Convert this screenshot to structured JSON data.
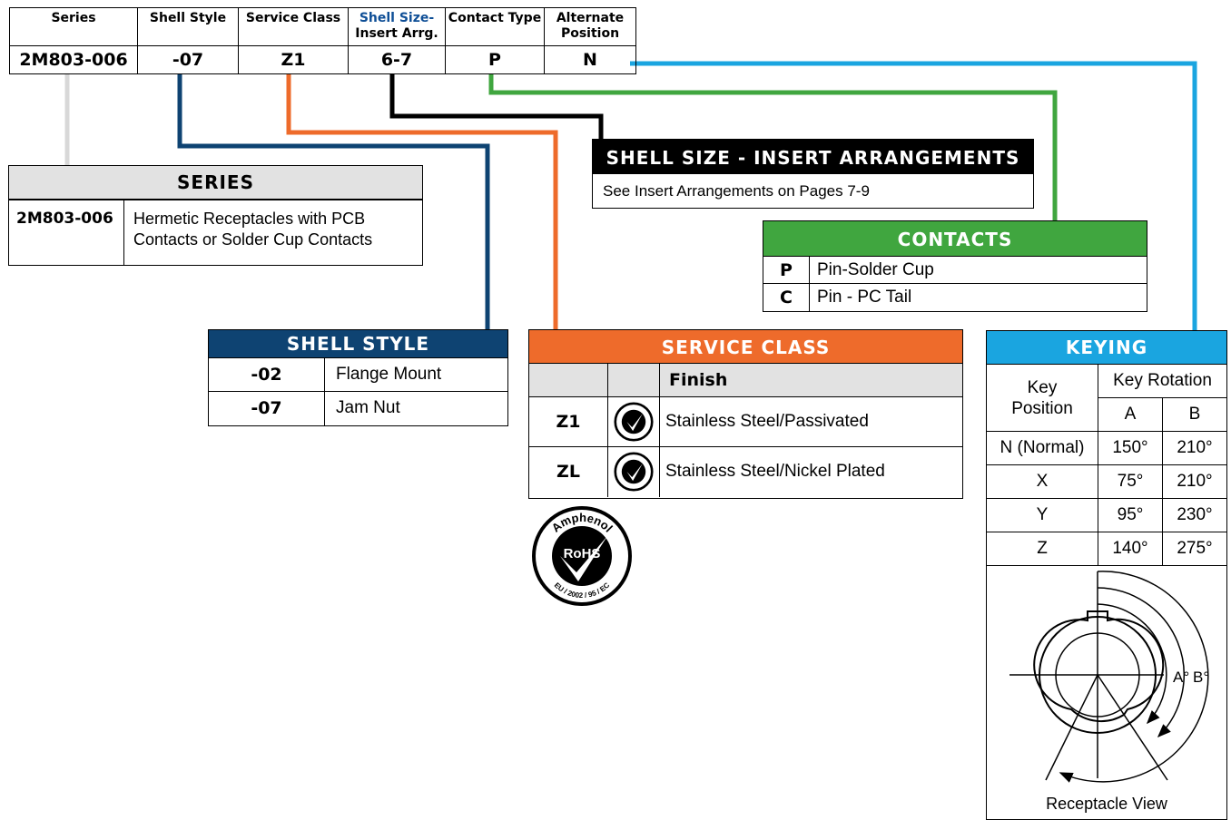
{
  "part_number": {
    "headers": [
      "Series",
      "Shell Style",
      "Service Class",
      "Shell Size-",
      "Insert Arrg.",
      "Contact Type",
      "Alternate",
      "Position"
    ],
    "values": [
      "2M803-006",
      "-07",
      "Z1",
      "6-7",
      "P",
      "N"
    ]
  },
  "series": {
    "title": "SERIES",
    "code": "2M803-006",
    "desc_line1": "Hermetic Receptacles with PCB",
    "desc_line2": "Contacts or Solder Cup Contacts"
  },
  "shell_style": {
    "title": "SHELL STYLE",
    "rows": [
      {
        "code": "-02",
        "desc": "Flange Mount"
      },
      {
        "code": "-07",
        "desc": "Jam Nut"
      }
    ]
  },
  "shell_size": {
    "title": "SHELL SIZE - INSERT ARRANGEMENTS",
    "text": "See Insert Arrangements on Pages 7-9"
  },
  "contacts": {
    "title": "CONTACTS",
    "rows": [
      {
        "code": "P",
        "desc": "Pin-Solder Cup"
      },
      {
        "code": "C",
        "desc": "Pin - PC Tail"
      }
    ]
  },
  "service_class": {
    "title": "SERVICE CLASS",
    "finish_header": "Finish",
    "rows": [
      {
        "code": "Z1",
        "desc": "Stainless Steel/Passivated"
      },
      {
        "code": "ZL",
        "desc": "Stainless Steel/Nickel Plated"
      }
    ]
  },
  "rohs": {
    "brand": "Amphenol",
    "mark": "RoHS",
    "directive": "EU / 2002 / 95 / EC"
  },
  "keying": {
    "title": "KEYING",
    "key_position_line1": "Key",
    "key_position_line2": "Position",
    "key_rotation": "Key Rotation",
    "col_a": "A",
    "col_b": "B",
    "rows": [
      {
        "pos": "N (Normal)",
        "a": "150°",
        "b": "210°"
      },
      {
        "pos": "X",
        "a": "75°",
        "b": "210°"
      },
      {
        "pos": "Y",
        "a": "95°",
        "b": "230°"
      },
      {
        "pos": "Z",
        "a": "140°",
        "b": "275°"
      }
    ],
    "label_a": "A°",
    "label_b": "B°",
    "caption": "Receptacle View"
  },
  "colors": {
    "series_line": "#d8d8d8",
    "shell_style": "#0e4372",
    "service_class": "#ee6b2b",
    "shell_size": "#000000",
    "contacts": "#40a63f",
    "keying": "#1aa5e0"
  }
}
